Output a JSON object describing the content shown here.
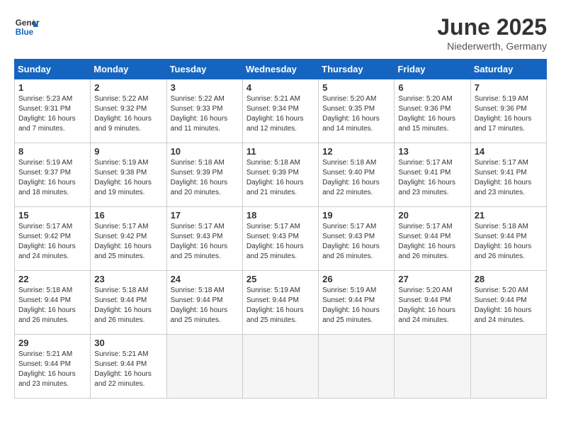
{
  "header": {
    "logo_line1": "General",
    "logo_line2": "Blue",
    "month": "June 2025",
    "location": "Niederwerth, Germany"
  },
  "weekdays": [
    "Sunday",
    "Monday",
    "Tuesday",
    "Wednesday",
    "Thursday",
    "Friday",
    "Saturday"
  ],
  "weeks": [
    [
      {
        "num": "1",
        "sr": "5:23 AM",
        "ss": "9:31 PM",
        "dl": "16 hours and 7 minutes."
      },
      {
        "num": "2",
        "sr": "5:22 AM",
        "ss": "9:32 PM",
        "dl": "16 hours and 9 minutes."
      },
      {
        "num": "3",
        "sr": "5:22 AM",
        "ss": "9:33 PM",
        "dl": "16 hours and 11 minutes."
      },
      {
        "num": "4",
        "sr": "5:21 AM",
        "ss": "9:34 PM",
        "dl": "16 hours and 12 minutes."
      },
      {
        "num": "5",
        "sr": "5:20 AM",
        "ss": "9:35 PM",
        "dl": "16 hours and 14 minutes."
      },
      {
        "num": "6",
        "sr": "5:20 AM",
        "ss": "9:36 PM",
        "dl": "16 hours and 15 minutes."
      },
      {
        "num": "7",
        "sr": "5:19 AM",
        "ss": "9:36 PM",
        "dl": "16 hours and 17 minutes."
      }
    ],
    [
      {
        "num": "8",
        "sr": "5:19 AM",
        "ss": "9:37 PM",
        "dl": "16 hours and 18 minutes."
      },
      {
        "num": "9",
        "sr": "5:19 AM",
        "ss": "9:38 PM",
        "dl": "16 hours and 19 minutes."
      },
      {
        "num": "10",
        "sr": "5:18 AM",
        "ss": "9:39 PM",
        "dl": "16 hours and 20 minutes."
      },
      {
        "num": "11",
        "sr": "5:18 AM",
        "ss": "9:39 PM",
        "dl": "16 hours and 21 minutes."
      },
      {
        "num": "12",
        "sr": "5:18 AM",
        "ss": "9:40 PM",
        "dl": "16 hours and 22 minutes."
      },
      {
        "num": "13",
        "sr": "5:17 AM",
        "ss": "9:41 PM",
        "dl": "16 hours and 23 minutes."
      },
      {
        "num": "14",
        "sr": "5:17 AM",
        "ss": "9:41 PM",
        "dl": "16 hours and 23 minutes."
      }
    ],
    [
      {
        "num": "15",
        "sr": "5:17 AM",
        "ss": "9:42 PM",
        "dl": "16 hours and 24 minutes."
      },
      {
        "num": "16",
        "sr": "5:17 AM",
        "ss": "9:42 PM",
        "dl": "16 hours and 25 minutes."
      },
      {
        "num": "17",
        "sr": "5:17 AM",
        "ss": "9:43 PM",
        "dl": "16 hours and 25 minutes."
      },
      {
        "num": "18",
        "sr": "5:17 AM",
        "ss": "9:43 PM",
        "dl": "16 hours and 25 minutes."
      },
      {
        "num": "19",
        "sr": "5:17 AM",
        "ss": "9:43 PM",
        "dl": "16 hours and 26 minutes."
      },
      {
        "num": "20",
        "sr": "5:17 AM",
        "ss": "9:44 PM",
        "dl": "16 hours and 26 minutes."
      },
      {
        "num": "21",
        "sr": "5:18 AM",
        "ss": "9:44 PM",
        "dl": "16 hours and 26 minutes."
      }
    ],
    [
      {
        "num": "22",
        "sr": "5:18 AM",
        "ss": "9:44 PM",
        "dl": "16 hours and 26 minutes."
      },
      {
        "num": "23",
        "sr": "5:18 AM",
        "ss": "9:44 PM",
        "dl": "16 hours and 26 minutes."
      },
      {
        "num": "24",
        "sr": "5:18 AM",
        "ss": "9:44 PM",
        "dl": "16 hours and 25 minutes."
      },
      {
        "num": "25",
        "sr": "5:19 AM",
        "ss": "9:44 PM",
        "dl": "16 hours and 25 minutes."
      },
      {
        "num": "26",
        "sr": "5:19 AM",
        "ss": "9:44 PM",
        "dl": "16 hours and 25 minutes."
      },
      {
        "num": "27",
        "sr": "5:20 AM",
        "ss": "9:44 PM",
        "dl": "16 hours and 24 minutes."
      },
      {
        "num": "28",
        "sr": "5:20 AM",
        "ss": "9:44 PM",
        "dl": "16 hours and 24 minutes."
      }
    ],
    [
      {
        "num": "29",
        "sr": "5:21 AM",
        "ss": "9:44 PM",
        "dl": "16 hours and 23 minutes."
      },
      {
        "num": "30",
        "sr": "5:21 AM",
        "ss": "9:44 PM",
        "dl": "16 hours and 22 minutes."
      },
      null,
      null,
      null,
      null,
      null
    ]
  ]
}
